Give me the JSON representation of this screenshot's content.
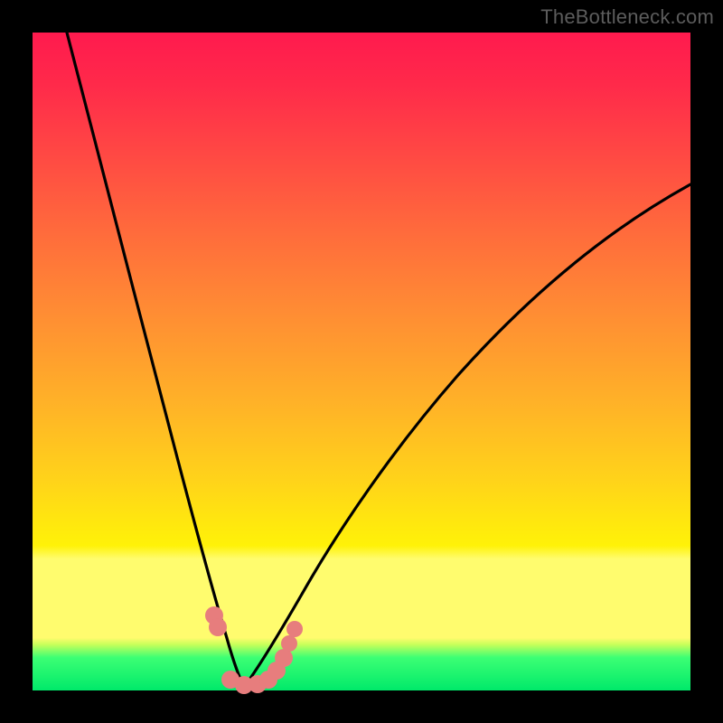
{
  "watermark": "TheBottleneck.com",
  "chart_data": {
    "type": "line",
    "title": "",
    "xlabel": "",
    "ylabel": "",
    "xlim": [
      0,
      100
    ],
    "ylim": [
      0,
      100
    ],
    "series": [
      {
        "name": "left-curve",
        "x": [
          5,
          8,
          12,
          16,
          20,
          24,
          26,
          27.5,
          29,
          30,
          31,
          32
        ],
        "values": [
          100,
          85,
          68,
          52,
          38,
          24,
          16,
          11,
          7,
          4,
          2,
          0
        ]
      },
      {
        "name": "right-curve",
        "x": [
          32,
          34,
          37,
          42,
          48,
          56,
          66,
          78,
          90,
          100
        ],
        "values": [
          0,
          3,
          7,
          14,
          23,
          34,
          47,
          59,
          69,
          77
        ]
      },
      {
        "name": "markers-pink",
        "x": [
          27.5,
          28.2,
          30,
          32,
          34,
          35.5,
          36.5,
          37.2,
          37.8
        ],
        "values": [
          11,
          9.5,
          1.5,
          0.5,
          0.7,
          1.5,
          3,
          5,
          8
        ]
      }
    ],
    "gradient_bands": [
      {
        "name": "red",
        "from": 100,
        "to": 78
      },
      {
        "name": "orange",
        "from": 78,
        "to": 56
      },
      {
        "name": "yellow",
        "from": 56,
        "to": 20
      },
      {
        "name": "pale-band",
        "from": 20,
        "to": 8
      },
      {
        "name": "green",
        "from": 8,
        "to": 0
      }
    ]
  }
}
